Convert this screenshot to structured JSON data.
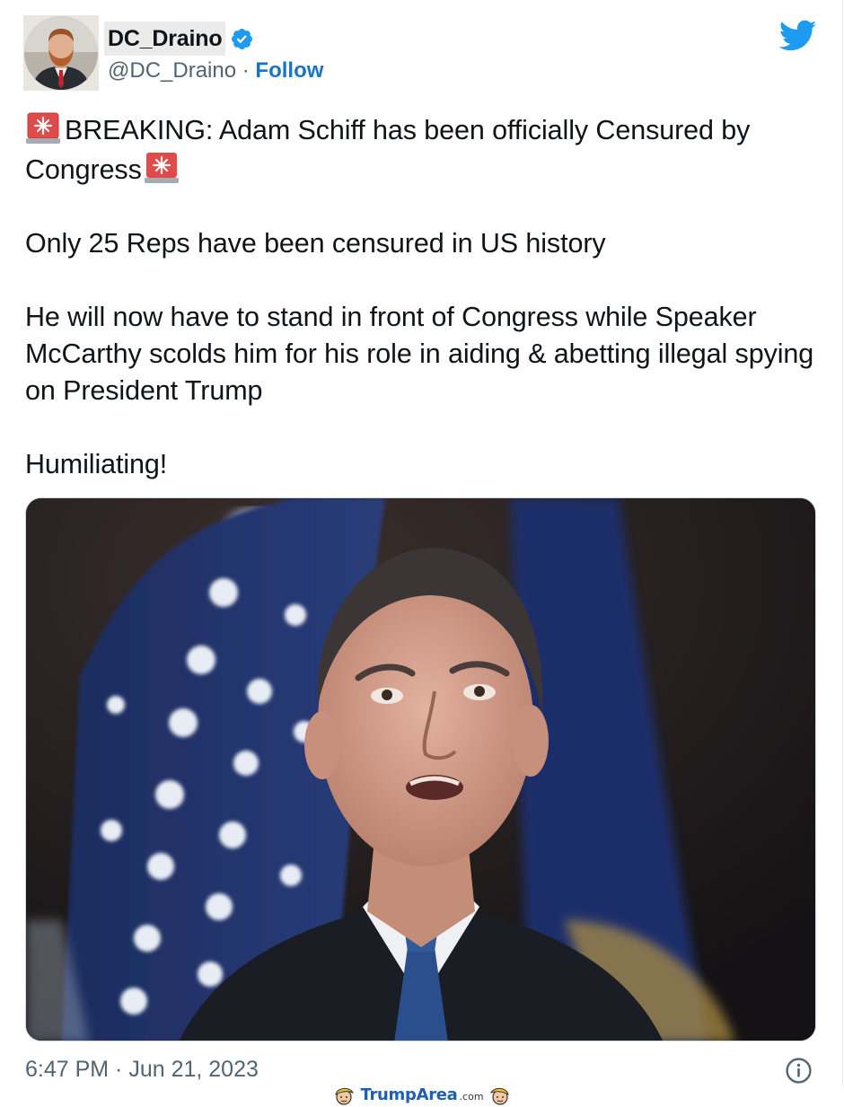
{
  "author": {
    "display_name": "DC_Draino",
    "handle": "@DC_Draino",
    "separator": " · ",
    "follow_label": "Follow",
    "verified_icon": "verified-badge-icon",
    "avatar_icon": "avatar-photo"
  },
  "platform": {
    "logo_icon": "twitter-bird-icon",
    "brand_color": "#1d9bf0"
  },
  "tweet": {
    "line1": "BREAKING: Adam Schiff has been officially Censured by Congress",
    "siren_icon": "rotating-light-emoji",
    "paragraph2": "Only 25 Reps have been censured in US history",
    "paragraph3": "He will now have to stand in front of Congress while Speaker McCarthy scolds him for his role in aiding & abetting illegal spying on President Trump",
    "paragraph4": "Humiliating!",
    "media_description_icon": "photo-man-in-front-of-flag"
  },
  "footer": {
    "timestamp": "6:47 PM · Jun 21, 2023",
    "info_icon": "info-icon"
  },
  "watermark": {
    "text": "TrumpArea",
    "suffix": ".com"
  }
}
